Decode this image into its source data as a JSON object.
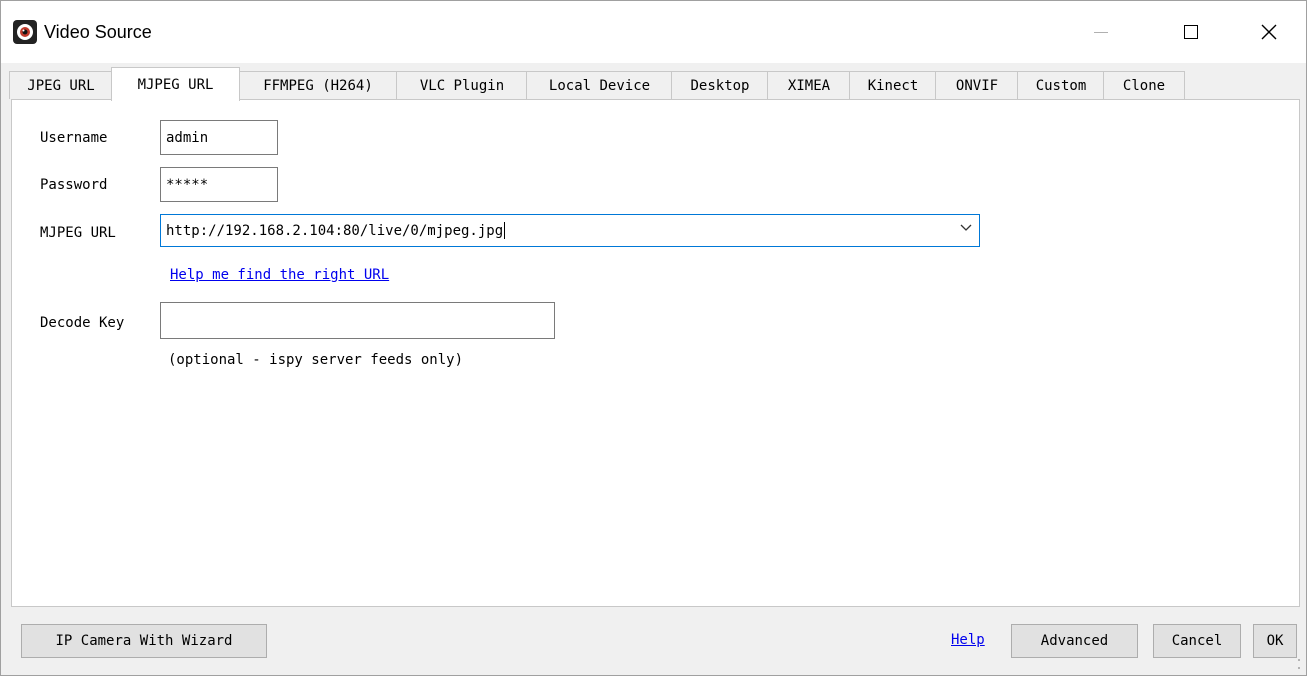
{
  "window": {
    "title": "Video Source",
    "icon": "eye-camera-icon",
    "controls": {
      "minimize": "minimize-icon",
      "maximize": "maximize-icon",
      "close": "close-icon"
    }
  },
  "tabs": [
    {
      "label": "JPEG URL"
    },
    {
      "label": "MJPEG URL",
      "active": true
    },
    {
      "label": "FFMPEG (H264)"
    },
    {
      "label": "VLC Plugin"
    },
    {
      "label": "Local Device"
    },
    {
      "label": "Desktop"
    },
    {
      "label": "XIMEA"
    },
    {
      "label": "Kinect"
    },
    {
      "label": "ONVIF"
    },
    {
      "label": "Custom"
    },
    {
      "label": "Clone"
    }
  ],
  "form": {
    "username_label": "Username",
    "username_value": "admin",
    "password_label": "Password",
    "password_value": "*****",
    "url_label": "MJPEG URL",
    "url_value": "http://192.168.2.104:80/live/0/mjpeg.jpg",
    "help_url_link": "Help me find the right URL",
    "decode_key_label": "Decode Key",
    "decode_key_value": "",
    "decode_key_hint": "(optional - ispy server feeds only)"
  },
  "footer": {
    "wizard_button": "IP Camera With Wizard",
    "help_link": "Help",
    "advanced_button": "Advanced",
    "cancel_button": "Cancel",
    "ok_button": "OK"
  },
  "colors": {
    "focus_border": "#0078d7",
    "link": "#0000ee",
    "button_face": "#e1e1e1"
  }
}
